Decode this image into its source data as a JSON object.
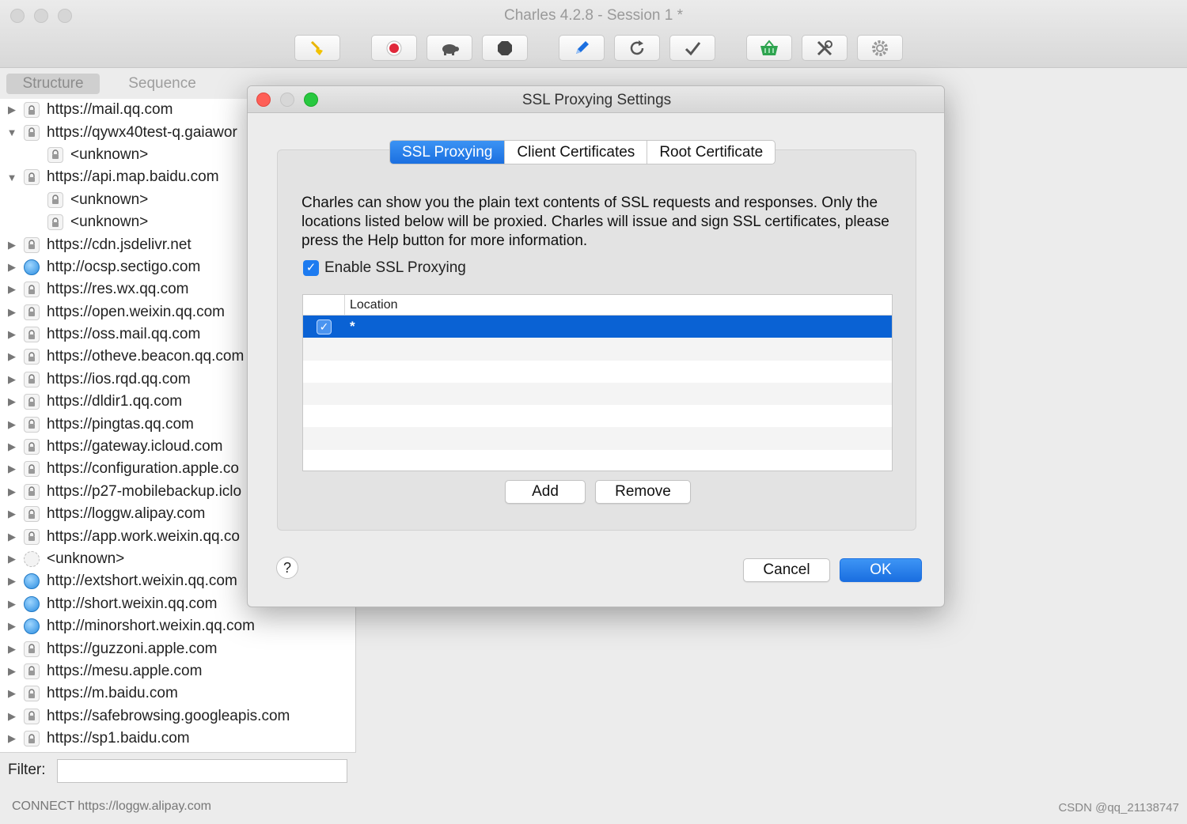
{
  "app": {
    "title": "Charles 4.2.8 - Session 1 *",
    "toolbar": [
      {
        "icon": "broom-icon",
        "color": "#e8b400"
      },
      {
        "icon": "record-icon",
        "color": "#e0283a"
      },
      {
        "icon": "turtle-icon",
        "color": "#555555"
      },
      {
        "icon": "stop-icon",
        "color": "#444444"
      },
      {
        "icon": "pen-icon",
        "color": "#1b6fe0"
      },
      {
        "icon": "refresh-icon",
        "color": "#555555"
      },
      {
        "icon": "check-icon",
        "color": "#555555"
      },
      {
        "icon": "basket-icon",
        "color": "#2ea44f"
      },
      {
        "icon": "tools-icon",
        "color": "#555555"
      },
      {
        "icon": "gear-icon",
        "color": "#999999"
      }
    ]
  },
  "left_panel": {
    "tabs": {
      "structure": "Structure",
      "sequence": "Sequence"
    },
    "tree": [
      {
        "label": "https://mail.qq.com",
        "icon": "lock",
        "expanded": false,
        "child": false
      },
      {
        "label": "https://qywx40test-q.gaiawor",
        "icon": "lock",
        "expanded": true,
        "child": false
      },
      {
        "label": "<unknown>",
        "icon": "lock",
        "expanded": null,
        "child": true
      },
      {
        "label": "https://api.map.baidu.com",
        "icon": "lock",
        "expanded": true,
        "child": false
      },
      {
        "label": "<unknown>",
        "icon": "lock",
        "expanded": null,
        "child": true
      },
      {
        "label": "<unknown>",
        "icon": "lock",
        "expanded": null,
        "child": true
      },
      {
        "label": "https://cdn.jsdelivr.net",
        "icon": "lock",
        "expanded": false,
        "child": false
      },
      {
        "label": "http://ocsp.sectigo.com",
        "icon": "globe",
        "expanded": false,
        "child": false
      },
      {
        "label": "https://res.wx.qq.com",
        "icon": "lock",
        "expanded": false,
        "child": false
      },
      {
        "label": "https://open.weixin.qq.com",
        "icon": "lock",
        "expanded": false,
        "child": false
      },
      {
        "label": "https://oss.mail.qq.com",
        "icon": "lock",
        "expanded": false,
        "child": false
      },
      {
        "label": "https://otheve.beacon.qq.com",
        "icon": "lock",
        "expanded": false,
        "child": false
      },
      {
        "label": "https://ios.rqd.qq.com",
        "icon": "lock",
        "expanded": false,
        "child": false
      },
      {
        "label": "https://dldir1.qq.com",
        "icon": "lock",
        "expanded": false,
        "child": false
      },
      {
        "label": "https://pingtas.qq.com",
        "icon": "lock",
        "expanded": false,
        "child": false
      },
      {
        "label": "https://gateway.icloud.com",
        "icon": "lock",
        "expanded": false,
        "child": false
      },
      {
        "label": "https://configuration.apple.co",
        "icon": "lock",
        "expanded": false,
        "child": false
      },
      {
        "label": "https://p27-mobilebackup.iclo",
        "icon": "lock",
        "expanded": false,
        "child": false
      },
      {
        "label": "https://loggw.alipay.com",
        "icon": "lock",
        "expanded": false,
        "child": false
      },
      {
        "label": "https://app.work.weixin.qq.co",
        "icon": "lock",
        "expanded": false,
        "child": false
      },
      {
        "label": "<unknown>",
        "icon": "unk",
        "expanded": false,
        "child": false
      },
      {
        "label": "http://extshort.weixin.qq.com",
        "icon": "globe",
        "expanded": false,
        "child": false
      },
      {
        "label": "http://short.weixin.qq.com",
        "icon": "globe",
        "expanded": false,
        "child": false
      },
      {
        "label": "http://minorshort.weixin.qq.com",
        "icon": "globe",
        "expanded": false,
        "child": false
      },
      {
        "label": "https://guzzoni.apple.com",
        "icon": "lock",
        "expanded": false,
        "child": false
      },
      {
        "label": "https://mesu.apple.com",
        "icon": "lock",
        "expanded": false,
        "child": false
      },
      {
        "label": "https://m.baidu.com",
        "icon": "lock",
        "expanded": false,
        "child": false
      },
      {
        "label": "https://safebrowsing.googleapis.com",
        "icon": "lock",
        "expanded": false,
        "child": false
      },
      {
        "label": "https://sp1.baidu.com",
        "icon": "lock",
        "expanded": false,
        "child": false
      }
    ],
    "filter_label": "Filter:",
    "filter_value": ""
  },
  "status": {
    "text": "CONNECT https://loggw.alipay.com",
    "watermark": "CSDN @qq_21138747"
  },
  "dialog": {
    "title": "SSL Proxying Settings",
    "tabs": [
      {
        "label": "SSL Proxying",
        "active": true
      },
      {
        "label": "Client Certificates",
        "active": false
      },
      {
        "label": "Root Certificate",
        "active": false
      }
    ],
    "description": "Charles can show you the plain text contents of SSL requests and responses. Only the locations listed below will be proxied. Charles will issue and sign SSL certificates, please press the Help button for more information.",
    "enable_label": "Enable SSL Proxying",
    "enable_checked": true,
    "table": {
      "column": "Location",
      "rows": [
        {
          "checked": true,
          "location": "*"
        }
      ]
    },
    "add_label": "Add",
    "remove_label": "Remove",
    "help_label": "?",
    "cancel_label": "Cancel",
    "ok_label": "OK"
  }
}
